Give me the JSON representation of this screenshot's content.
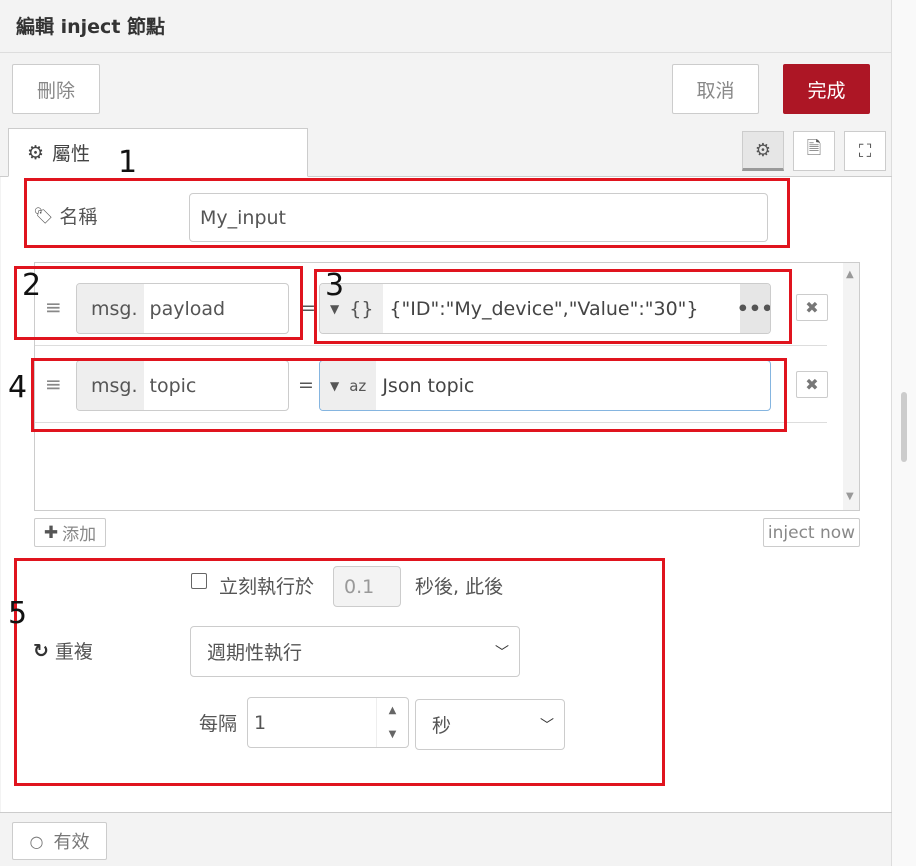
{
  "header": {
    "title": "編輯 inject 節點",
    "delete_label": "刪除",
    "cancel_label": "取消",
    "done_label": "完成"
  },
  "tabs": {
    "properties_label": "屬性"
  },
  "form": {
    "name_label": "名稱",
    "name_value": "My_input",
    "rows": [
      {
        "prefix": "msg.",
        "property": "payload",
        "eq": "=",
        "type_icon": "{}",
        "value": "{\"ID\":\"My_device\",\"Value\":\"30\"}",
        "more": "•••"
      },
      {
        "prefix": "msg.",
        "property": "topic",
        "eq": "=",
        "type_icon": "az",
        "value": "Json topic"
      }
    ],
    "add_label": "添加",
    "inject_now_label": "inject now",
    "once_label": "立刻執行於",
    "once_delay": "0.1",
    "once_suffix": "秒後, 此後",
    "repeat_label": "重複",
    "repeat_select": "週期性執行",
    "every_label": "每隔",
    "every_value": "1",
    "unit_select": "秒"
  },
  "footer": {
    "enabled_label": "有效"
  },
  "annotations": [
    "1",
    "2",
    "3",
    "4",
    "5"
  ],
  "colors": {
    "primary": "#ad1625",
    "highlight": "#e0141e"
  }
}
